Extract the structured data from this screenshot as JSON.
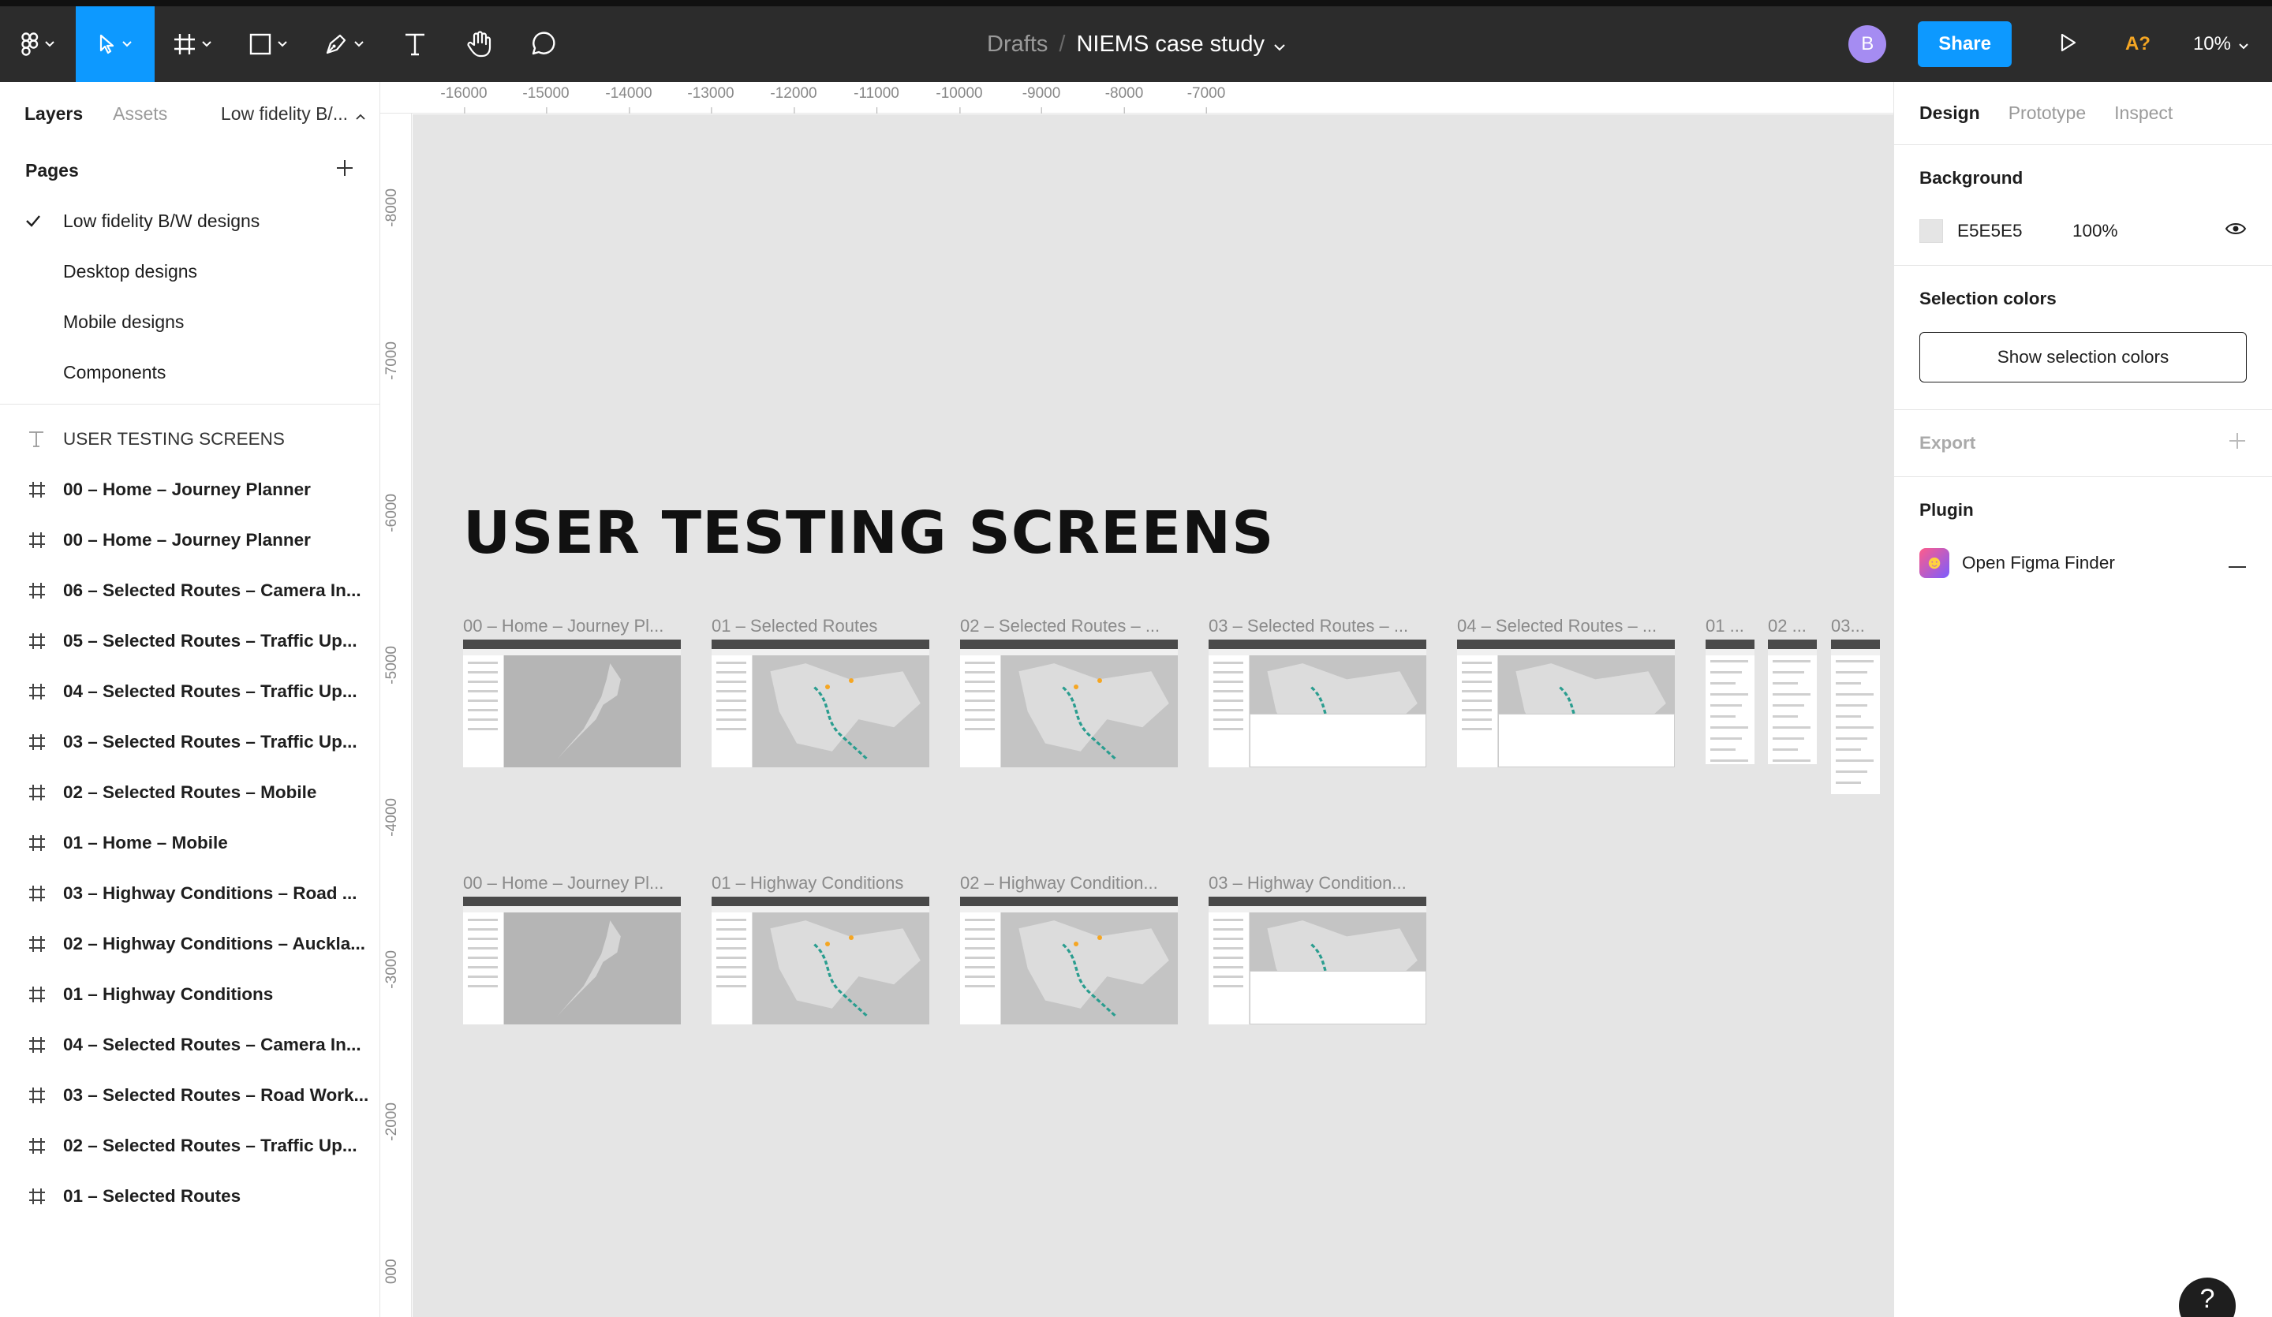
{
  "toolbar": {
    "breadcrumb_root": "Drafts",
    "breadcrumb_sep": "/",
    "file_name": "NIEMS case study",
    "avatar_initial": "B",
    "share_label": "Share",
    "a11y_label": "A?",
    "zoom_label": "10%"
  },
  "left_panel": {
    "tab_layers": "Layers",
    "tab_assets": "Assets",
    "current_page": "Low fidelity B/...",
    "pages_title": "Pages",
    "pages": [
      {
        "label": "Low fidelity B/W designs",
        "selected": true
      },
      {
        "label": "Desktop designs"
      },
      {
        "label": "Mobile designs"
      },
      {
        "label": "Components"
      }
    ],
    "layers": [
      {
        "label": "USER TESTING SCREENS",
        "kind": "text"
      },
      {
        "label": "00 – Home – Journey Planner",
        "kind": "frame"
      },
      {
        "label": "00 – Home – Journey Planner",
        "kind": "frame"
      },
      {
        "label": "06 – Selected Routes – Camera In...",
        "kind": "frame"
      },
      {
        "label": "05 – Selected Routes – Traffic Up...",
        "kind": "frame"
      },
      {
        "label": "04 – Selected Routes – Traffic Up...",
        "kind": "frame"
      },
      {
        "label": "03 – Selected Routes – Traffic Up...",
        "kind": "frame"
      },
      {
        "label": "02 – Selected Routes – Mobile",
        "kind": "frame"
      },
      {
        "label": "01 – Home – Mobile",
        "kind": "frame"
      },
      {
        "label": "03 – Highway Conditions – Road ...",
        "kind": "frame"
      },
      {
        "label": "02 – Highway Conditions – Auckla...",
        "kind": "frame"
      },
      {
        "label": "01 – Highway Conditions",
        "kind": "frame"
      },
      {
        "label": "04 – Selected Routes – Camera In...",
        "kind": "frame"
      },
      {
        "label": "03 – Selected Routes – Road Work...",
        "kind": "frame"
      },
      {
        "label": "02 – Selected Routes – Traffic Up...",
        "kind": "frame"
      },
      {
        "label": "01 – Selected Routes",
        "kind": "frame"
      }
    ]
  },
  "rulers": {
    "top": [
      "-16000",
      "-15000",
      "-14000",
      "-13000",
      "-12000",
      "-11000",
      "-10000",
      "-9000",
      "-8000",
      "-7000"
    ],
    "left": [
      "-8000",
      "-7000",
      "-6000",
      "-5000",
      "-4000",
      "-3000",
      "-2000",
      "000"
    ]
  },
  "canvas": {
    "title": "USER TESTING SCREENS",
    "row1_labels": [
      "00 – Home – Journey Pl...",
      "01 – Selected Routes",
      "02 – Selected Routes – ...",
      "03 – Selected Routes – ...",
      "04 – Selected Routes – ...",
      "01 ...",
      "02 ...",
      "03..."
    ],
    "row2_labels": [
      "00 – Home – Journey Pl...",
      "01 – Highway Conditions",
      "02 – Highway Condition...",
      "03 – Highway Condition..."
    ]
  },
  "right_panel": {
    "tab_design": "Design",
    "tab_prototype": "Prototype",
    "tab_inspect": "Inspect",
    "background_title": "Background",
    "background_hex": "E5E5E5",
    "background_opacity": "100%",
    "selection_colors_title": "Selection colors",
    "show_selection_colors": "Show selection colors",
    "export_title": "Export",
    "plugin_title": "Plugin",
    "plugin_name": "Open Figma Finder"
  },
  "help_label": "?",
  "colors": {
    "toolbar_bg": "#2c2c2c",
    "accent": "#0d99ff",
    "canvas_bg": "#e5e5e5",
    "avatar": "#a58cf2",
    "a11y": "#f5a623"
  }
}
